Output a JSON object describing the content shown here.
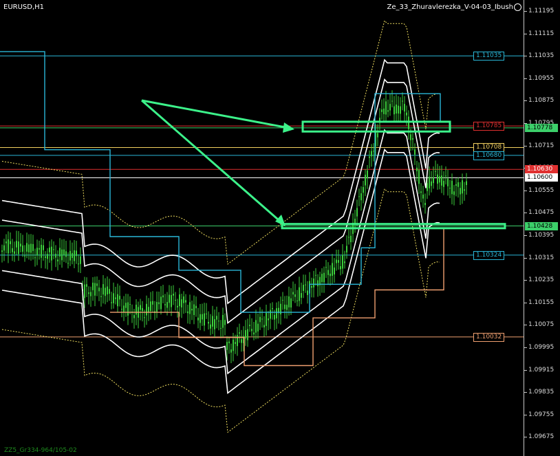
{
  "chart": {
    "symbol": "EURUSD,H1",
    "indicator_name": "Ze_33_Zhuravlerezka_V-04-03_Ibush",
    "footer": "ZZ5_Gr334-964/105-02"
  },
  "price_axis": {
    "ticks": [
      "1.11195",
      "1.11115",
      "1.11035",
      "1.10955",
      "1.10875",
      "1.10795",
      "1.10715",
      "1.10635",
      "1.10555",
      "1.10475",
      "1.10395",
      "1.10315",
      "1.10235",
      "1.10155",
      "1.10075",
      "1.09995",
      "1.09915",
      "1.09835",
      "1.09755",
      "1.09675"
    ]
  },
  "levels": [
    {
      "price": "1.11035",
      "color": "#2ab7d8",
      "flag": "1.11035",
      "flag_on_axis": false
    },
    {
      "price": "1.10785",
      "color": "#e03030",
      "flag": "1.10785",
      "flag_on_axis": false
    },
    {
      "price": "1.10778",
      "color": "#3ccf6a",
      "flag": "1.10778",
      "flag_on_axis": true
    },
    {
      "price": "1.10708",
      "color": "#f2d060",
      "flag": "1.10708",
      "flag_on_axis": false
    },
    {
      "price": "1.10680",
      "color": "#2ab7d8",
      "flag": "1.10680",
      "flag_on_axis": false
    },
    {
      "price": "1.10630",
      "color": "#e03030",
      "flag": "1.10630",
      "flag_on_axis": true
    },
    {
      "price": "1.10600",
      "color": "#ffffff",
      "flag": "1.10600",
      "flag_on_axis": true
    },
    {
      "price": "1.10428",
      "color": "#3ccf6a",
      "flag": "1.10428",
      "flag_on_axis": true
    },
    {
      "price": "1.10324",
      "color": "#2ab7d8",
      "flag": "1.10324",
      "flag_on_axis": false
    },
    {
      "price": "1.10032",
      "color": "#f0a070",
      "flag": "1.10032",
      "flag_on_axis": false
    }
  ],
  "colors": {
    "background": "#000000",
    "candle": "#3ccf3c",
    "bollinger": "#ffffff",
    "cyan_channel": "#2ab7d8",
    "orange_channel": "#f0a070",
    "annotation": "#3cf28a",
    "ma_dotted": "#f2e060"
  }
}
